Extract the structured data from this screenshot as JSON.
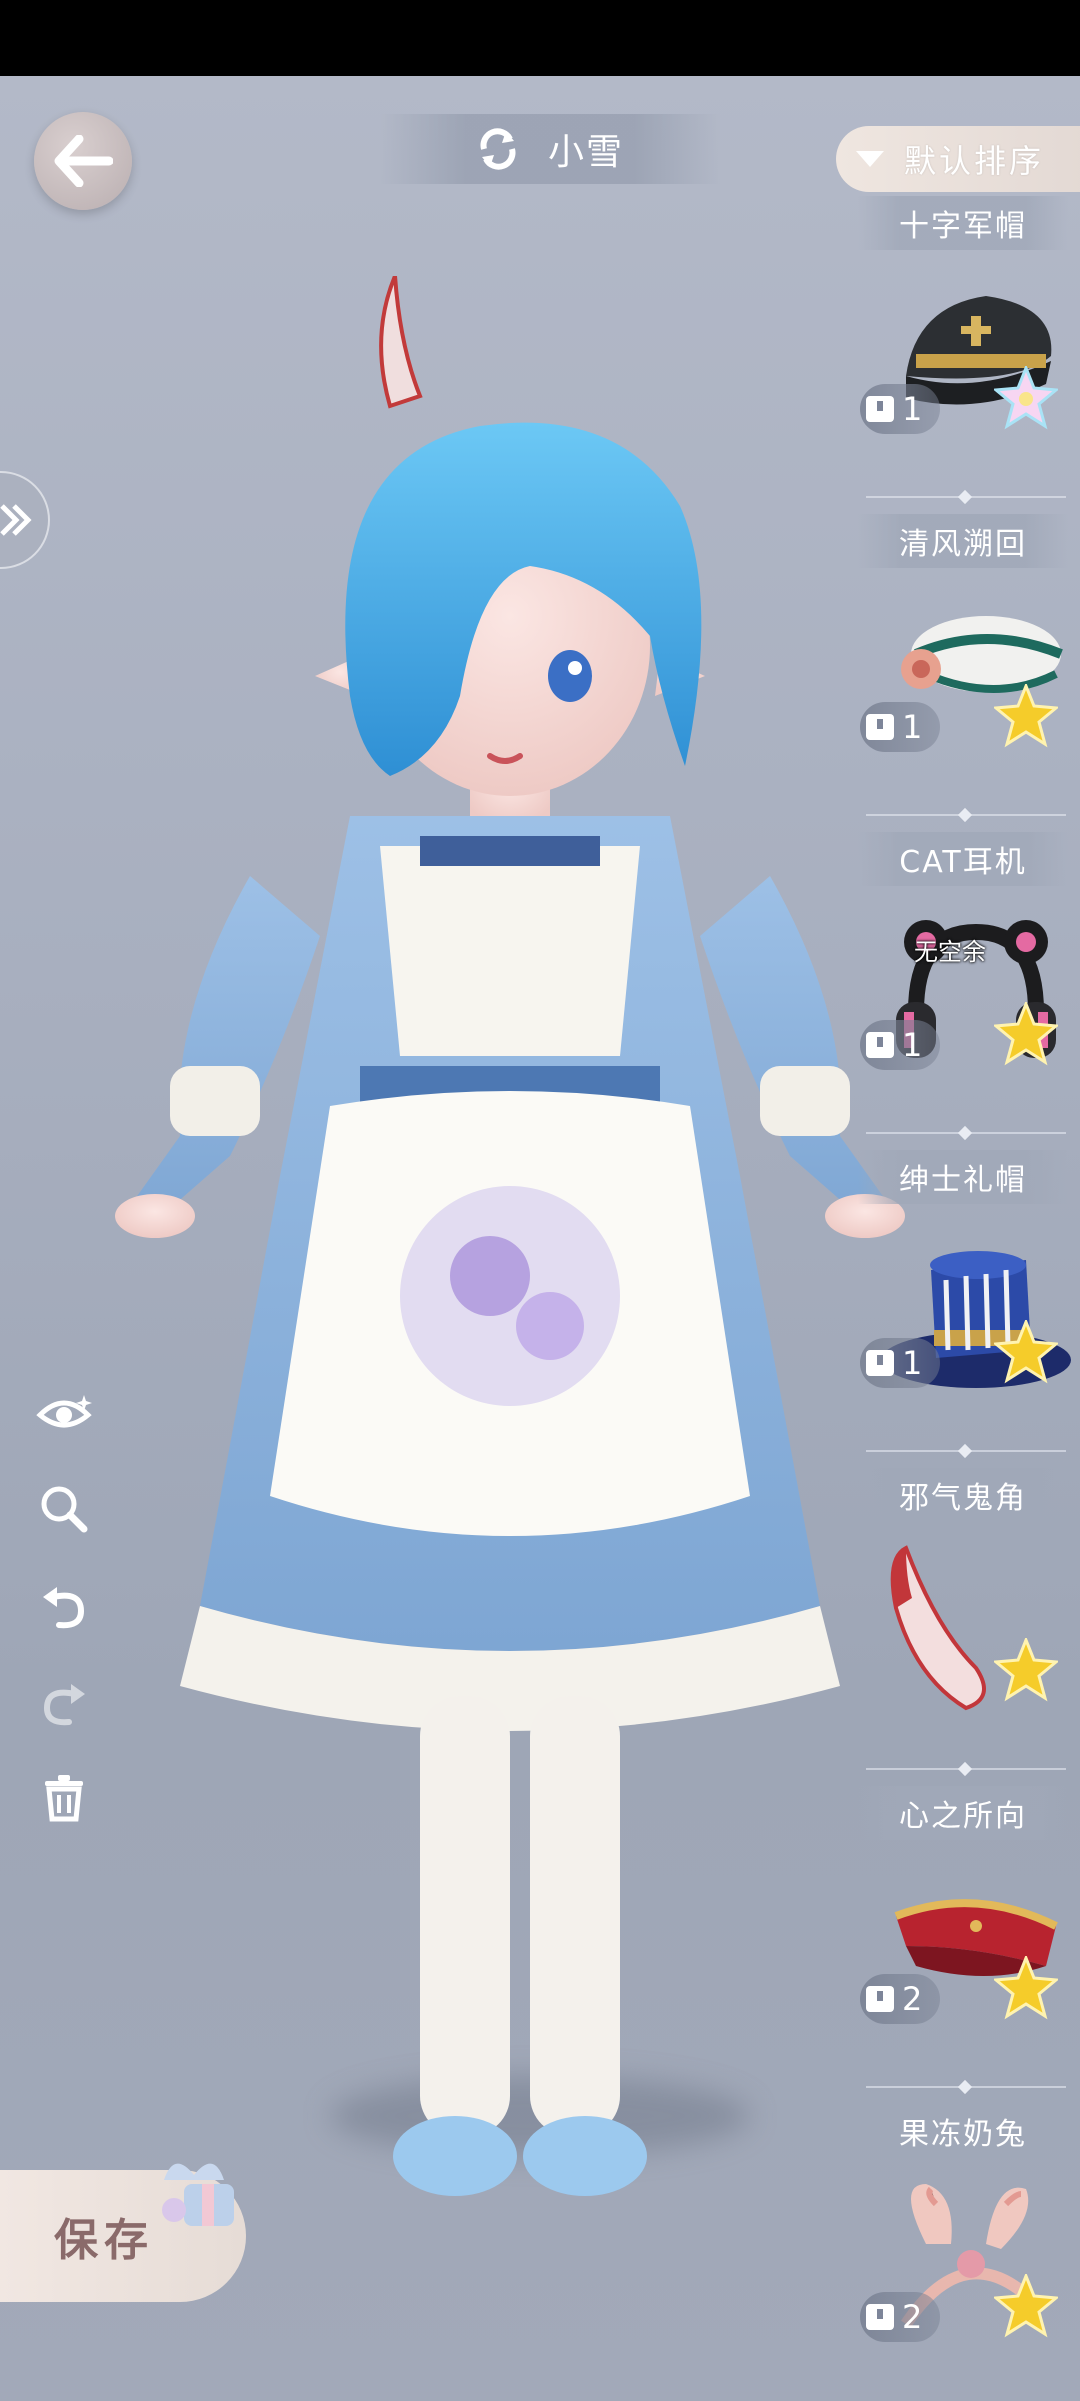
{
  "header": {
    "character_name": "小雪",
    "sort_label": "默认排序"
  },
  "save": {
    "label": "保存"
  },
  "tools": [
    "eye-icon",
    "zoom-icon",
    "undo-icon",
    "redo-icon",
    "trash-icon"
  ],
  "items": [
    {
      "name": "十字军帽",
      "count": "1",
      "star": "rainbow"
    },
    {
      "name": "清风溯回",
      "count": "1",
      "star": "gold"
    },
    {
      "name": "CAT耳机",
      "count": "1",
      "star": "gold",
      "overlay_label": "无空余"
    },
    {
      "name": "绅士礼帽",
      "count": "1",
      "star": "gold"
    },
    {
      "name": "邪气鬼角",
      "count": "",
      "star": "gold"
    },
    {
      "name": "心之所向",
      "count": "2",
      "star": "gold"
    },
    {
      "name": "果冻奶兔",
      "count": "2",
      "star": "gold"
    }
  ],
  "colors": {
    "background": "#a9b0c0",
    "dress_blue": "#8fb2d9",
    "hair_blue": "#4fb3ea",
    "star_gold": "#f5cc2a"
  }
}
